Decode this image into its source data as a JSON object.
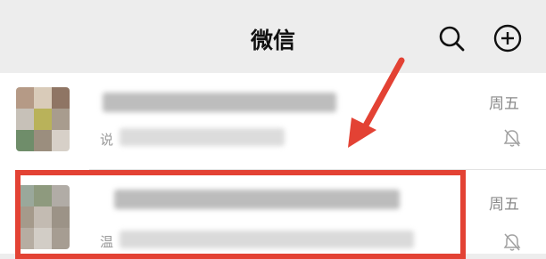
{
  "header": {
    "title": "微信",
    "search_icon": "search-icon",
    "add_icon": "plus-circle-icon"
  },
  "chats": [
    {
      "time": "周五",
      "preview_prefix": "说",
      "muted": true
    },
    {
      "time": "周五",
      "preview_prefix": "温",
      "muted": true
    }
  ],
  "annotation": {
    "arrow_color": "#e34234",
    "box_color": "#e34234"
  }
}
